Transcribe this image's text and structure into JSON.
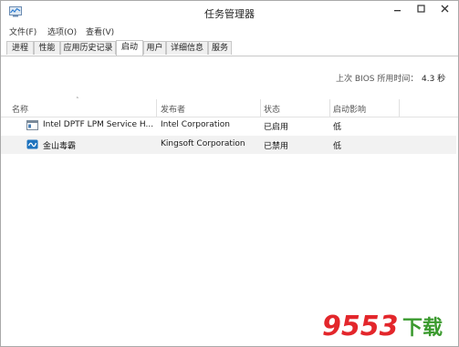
{
  "window": {
    "title": "任务管理器"
  },
  "menu": [
    "文件(F)",
    "选项(O)",
    "查看(V)"
  ],
  "tabs": [
    {
      "label": "进程"
    },
    {
      "label": "性能"
    },
    {
      "label": "应用历史记录"
    },
    {
      "label": "启动",
      "active": true
    },
    {
      "label": "用户"
    },
    {
      "label": "详细信息"
    },
    {
      "label": "服务"
    }
  ],
  "bios": {
    "label": "上次 BIOS 所用时间：",
    "value": "4.3 秒"
  },
  "columns": {
    "name": "名称",
    "publisher": "发布者",
    "status": "状态",
    "impact": "启动影响"
  },
  "rows": [
    {
      "name": "Intel DPTF LPM Service H...",
      "publisher": "Intel Corporation",
      "status": "已启用",
      "impact": "低",
      "icon": "app-window-icon"
    },
    {
      "name": "金山毒霸",
      "publisher": "Kingsoft Corporation",
      "status": "已禁用",
      "impact": "低",
      "icon": "kingsoft-shield-icon"
    }
  ],
  "watermark": {
    "text": "9553",
    "suffix": "下载"
  },
  "colors": {
    "accent": "#1e73be",
    "watermark_red": "#e3262b",
    "watermark_green": "#3a9a2e"
  }
}
